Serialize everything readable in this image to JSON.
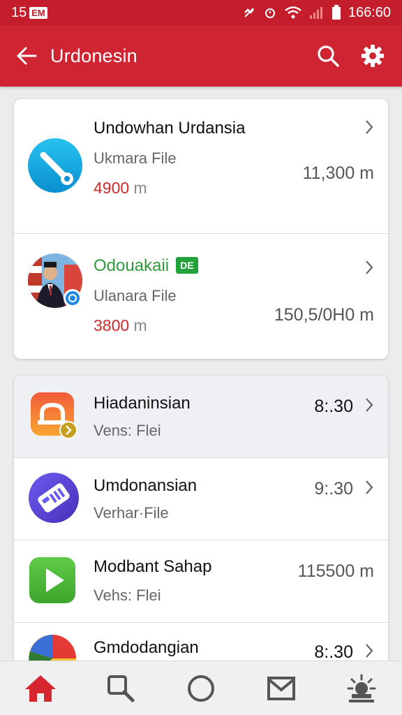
{
  "status_bar": {
    "time_left": "15",
    "badge": "EM",
    "time_right": "166:60"
  },
  "app_bar": {
    "title": "Urdonesin"
  },
  "featured": [
    {
      "title": "Undowhan Urdansia",
      "subtitle": "Ukmara File",
      "amount": "4900",
      "amount_unit": " m",
      "value": "11,300 m",
      "icon": "link-tool-icon"
    },
    {
      "title": "Odouakaii",
      "tag": "DE",
      "subtitle": "Ulanara File",
      "amount": "3800",
      "amount_unit": " m",
      "value": "150,5/0H0 m",
      "icon": "person-avatar"
    }
  ],
  "list": [
    {
      "title": "Hiadaninsian",
      "subtitle": "Vens: Flei",
      "value": "8:.30",
      "icon": "orange-app-icon"
    },
    {
      "title": "Umdonansian",
      "subtitle": "Verhar·File",
      "value": "9:.30",
      "icon": "purple-app-icon"
    },
    {
      "title": "Modbant Sahap",
      "subtitle": "Vehs: Flei",
      "value": "115500 m",
      "icon": "play-icon"
    },
    {
      "title": "Gmdodangian",
      "subtitle": "",
      "value": "8:.30",
      "icon": "colorful-app-icon"
    }
  ],
  "colors": {
    "primary": "#cf2533",
    "accent_green": "#22a33a",
    "amount_red": "#d02a2a"
  },
  "bottom_nav": [
    "home-icon",
    "search-icon",
    "circle-icon",
    "mail-icon",
    "settings-icon"
  ]
}
